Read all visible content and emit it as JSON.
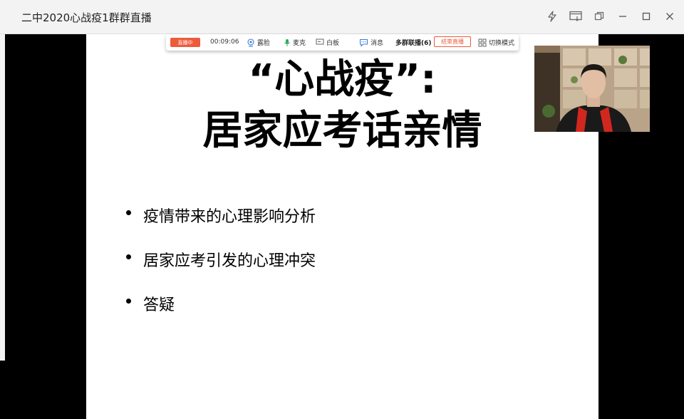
{
  "window": {
    "title": "二中2020心战疫1群群直播"
  },
  "slide": {
    "title_line1": "“心战疫”:",
    "title_line2": "居家应考话亲情",
    "bullets": [
      "疫情带来的心理影响分析",
      "居家应考引发的心理冲突",
      "答疑"
    ]
  },
  "toolbar": {
    "live_label": "直播中",
    "timer": "00:09:06",
    "face_label": "露脸",
    "mic_label": "麦克",
    "whiteboard_label": "白板",
    "message_label": "消息",
    "multi_group_label": "多群联播(6)",
    "end_live_label": "结束直播",
    "switch_mode_label": "切换模式"
  },
  "colors": {
    "accent": "#ee5a3a",
    "titlebar": "#f3f3f3"
  }
}
